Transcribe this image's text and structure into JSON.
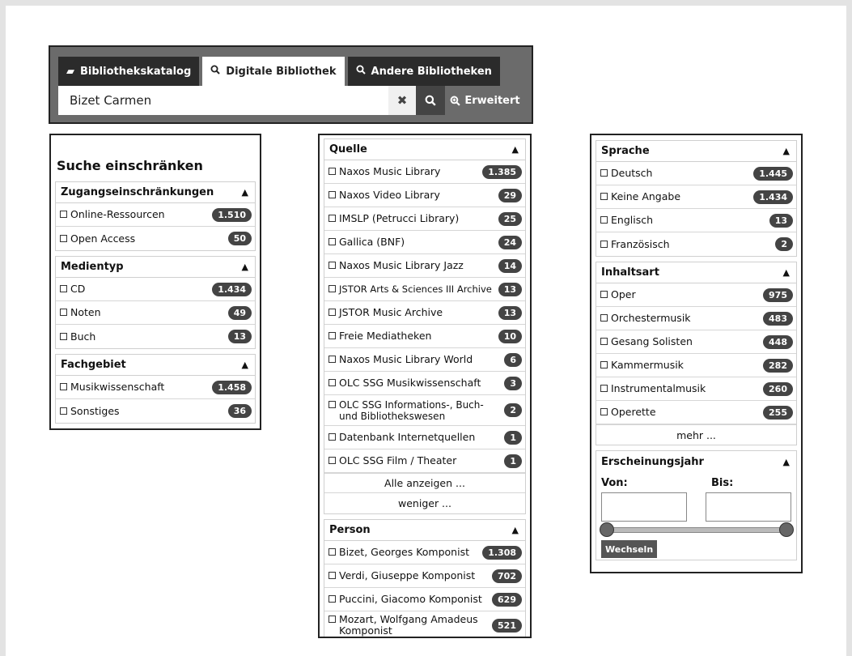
{
  "search": {
    "tabs": [
      {
        "label": "Bibliothekskatalog",
        "icon": "book-icon"
      },
      {
        "label": "Digitale Bibliothek",
        "icon": "search-icon"
      },
      {
        "label": "Andere Bibliotheken",
        "icon": "search-icon"
      }
    ],
    "query": "Bizet Carmen",
    "clear_symbol": "✖",
    "advanced_label": "Erweitert"
  },
  "left": {
    "heading": "Suche einschränken",
    "groups": [
      {
        "title": "Zugangseinschränkungen",
        "items": [
          {
            "label": "Online-Ressourcen",
            "count": "1.510"
          },
          {
            "label": "Open Access",
            "count": "50"
          }
        ]
      },
      {
        "title": "Medientyp",
        "items": [
          {
            "label": "CD",
            "count": "1.434"
          },
          {
            "label": "Noten",
            "count": "49"
          },
          {
            "label": "Buch",
            "count": "13"
          }
        ]
      },
      {
        "title": "Fachgebiet",
        "items": [
          {
            "label": "Musikwissenschaft",
            "count": "1.458"
          },
          {
            "label": "Sonstiges",
            "count": "36"
          }
        ]
      }
    ]
  },
  "middle": {
    "quelle": {
      "title": "Quelle",
      "items": [
        {
          "label": "Naxos Music Library",
          "count": "1.385"
        },
        {
          "label": "Naxos Video Library",
          "count": "29"
        },
        {
          "label": "IMSLP (Petrucci Library)",
          "count": "25"
        },
        {
          "label": "Gallica (BNF)",
          "count": "24"
        },
        {
          "label": "Naxos Music Library Jazz",
          "count": "14"
        },
        {
          "label": "JSTOR Arts & Sciences III Archive",
          "count": "13"
        },
        {
          "label": "JSTOR Music Archive",
          "count": "13"
        },
        {
          "label": "Freie Mediatheken",
          "count": "10"
        },
        {
          "label": "Naxos Music Library World",
          "count": "6"
        },
        {
          "label": "OLC SSG Musikwissenschaft",
          "count": "3"
        },
        {
          "label": "OLC SSG Informations-, Buch- und Bibliothekswesen",
          "count": "2"
        },
        {
          "label": "Datenbank Internetquellen",
          "count": "1"
        },
        {
          "label": "OLC SSG Film / Theater",
          "count": "1"
        }
      ],
      "show_all": "Alle anzeigen ...",
      "show_less": "weniger ..."
    },
    "person": {
      "title": "Person",
      "items": [
        {
          "label": "Bizet, Georges Komponist",
          "count": "1.308"
        },
        {
          "label": "Verdi, Giuseppe Komponist",
          "count": "702"
        },
        {
          "label": "Puccini, Giacomo Komponist",
          "count": "629"
        },
        {
          "label": "Mozart, Wolfgang Amadeus Komponist",
          "count": "521"
        }
      ]
    }
  },
  "right": {
    "sprache": {
      "title": "Sprache",
      "items": [
        {
          "label": "Deutsch",
          "count": "1.445"
        },
        {
          "label": "Keine Angabe",
          "count": "1.434"
        },
        {
          "label": "Englisch",
          "count": "13"
        },
        {
          "label": "Französisch",
          "count": "2"
        }
      ]
    },
    "inhaltsart": {
      "title": "Inhaltsart",
      "items": [
        {
          "label": "Oper",
          "count": "975"
        },
        {
          "label": "Orchestermusik",
          "count": "483"
        },
        {
          "label": "Gesang Solisten",
          "count": "448"
        },
        {
          "label": "Kammermusik",
          "count": "282"
        },
        {
          "label": "Instrumentalmusik",
          "count": "260"
        },
        {
          "label": "Operette",
          "count": "255"
        }
      ],
      "more": "mehr ..."
    },
    "year": {
      "title": "Erscheinungsjahr",
      "from_label": "Von:",
      "to_label": "Bis:",
      "apply_label": "Wechseln"
    }
  },
  "caret_symbol": "▲"
}
